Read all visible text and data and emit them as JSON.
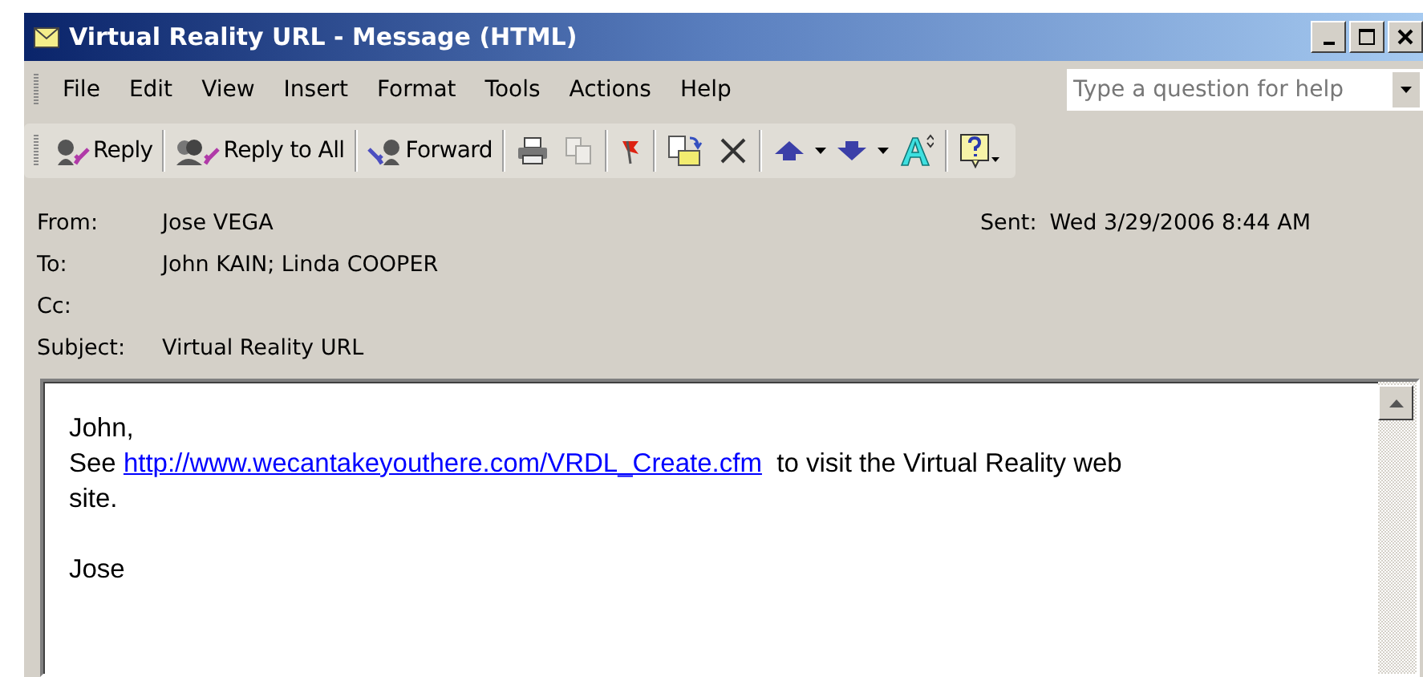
{
  "window": {
    "title": "Virtual Reality URL - Message (HTML)"
  },
  "menu": [
    "File",
    "Edit",
    "View",
    "Insert",
    "Format",
    "Tools",
    "Actions",
    "Help"
  ],
  "help_search": {
    "placeholder": "Type a question for help"
  },
  "toolbar": [
    {
      "kind": "reply",
      "label": "Reply"
    },
    {
      "kind": "reply_all",
      "label": "Reply to All"
    },
    {
      "kind": "forward",
      "label": "Forward"
    }
  ],
  "header": {
    "fields": [
      {
        "label": "From:",
        "value": "Jose VEGA"
      },
      {
        "label": "To:",
        "value": "John KAIN; Linda COOPER"
      },
      {
        "label": "Cc:"
      },
      {
        "label": "Subject:",
        "value": "Virtual Reality URL"
      }
    ],
    "sent": {
      "label": "Sent:",
      "value": "Wed 3/29/2006 8:44 AM"
    }
  },
  "body": {
    "greeting": "John,",
    "before_link": "See",
    "link": "http://www.wecantakeyouthere.com/VRDL_Create.cfm",
    "after_link": "to visit the Virtual Reality web site.",
    "signature": "Jose"
  }
}
